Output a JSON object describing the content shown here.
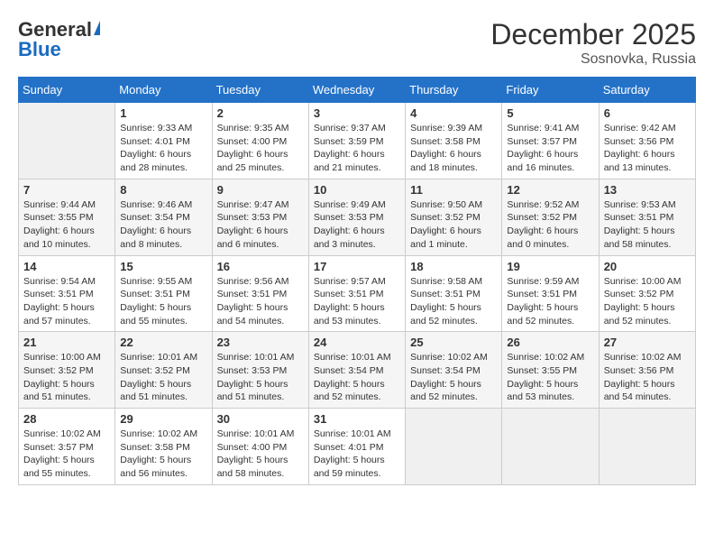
{
  "header": {
    "logo_general": "General",
    "logo_blue": "Blue",
    "month_title": "December 2025",
    "location": "Sosnovka, Russia"
  },
  "days_of_week": [
    "Sunday",
    "Monday",
    "Tuesday",
    "Wednesday",
    "Thursday",
    "Friday",
    "Saturday"
  ],
  "weeks": [
    [
      {
        "day": "",
        "sunrise": "",
        "sunset": "",
        "daylight": ""
      },
      {
        "day": "1",
        "sunrise": "9:33 AM",
        "sunset": "4:01 PM",
        "daylight": "6 hours and 28 minutes."
      },
      {
        "day": "2",
        "sunrise": "9:35 AM",
        "sunset": "4:00 PM",
        "daylight": "6 hours and 25 minutes."
      },
      {
        "day": "3",
        "sunrise": "9:37 AM",
        "sunset": "3:59 PM",
        "daylight": "6 hours and 21 minutes."
      },
      {
        "day": "4",
        "sunrise": "9:39 AM",
        "sunset": "3:58 PM",
        "daylight": "6 hours and 18 minutes."
      },
      {
        "day": "5",
        "sunrise": "9:41 AM",
        "sunset": "3:57 PM",
        "daylight": "6 hours and 16 minutes."
      },
      {
        "day": "6",
        "sunrise": "9:42 AM",
        "sunset": "3:56 PM",
        "daylight": "6 hours and 13 minutes."
      }
    ],
    [
      {
        "day": "7",
        "sunrise": "9:44 AM",
        "sunset": "3:55 PM",
        "daylight": "6 hours and 10 minutes."
      },
      {
        "day": "8",
        "sunrise": "9:46 AM",
        "sunset": "3:54 PM",
        "daylight": "6 hours and 8 minutes."
      },
      {
        "day": "9",
        "sunrise": "9:47 AM",
        "sunset": "3:53 PM",
        "daylight": "6 hours and 6 minutes."
      },
      {
        "day": "10",
        "sunrise": "9:49 AM",
        "sunset": "3:53 PM",
        "daylight": "6 hours and 3 minutes."
      },
      {
        "day": "11",
        "sunrise": "9:50 AM",
        "sunset": "3:52 PM",
        "daylight": "6 hours and 1 minute."
      },
      {
        "day": "12",
        "sunrise": "9:52 AM",
        "sunset": "3:52 PM",
        "daylight": "6 hours and 0 minutes."
      },
      {
        "day": "13",
        "sunrise": "9:53 AM",
        "sunset": "3:51 PM",
        "daylight": "5 hours and 58 minutes."
      }
    ],
    [
      {
        "day": "14",
        "sunrise": "9:54 AM",
        "sunset": "3:51 PM",
        "daylight": "5 hours and 57 minutes."
      },
      {
        "day": "15",
        "sunrise": "9:55 AM",
        "sunset": "3:51 PM",
        "daylight": "5 hours and 55 minutes."
      },
      {
        "day": "16",
        "sunrise": "9:56 AM",
        "sunset": "3:51 PM",
        "daylight": "5 hours and 54 minutes."
      },
      {
        "day": "17",
        "sunrise": "9:57 AM",
        "sunset": "3:51 PM",
        "daylight": "5 hours and 53 minutes."
      },
      {
        "day": "18",
        "sunrise": "9:58 AM",
        "sunset": "3:51 PM",
        "daylight": "5 hours and 52 minutes."
      },
      {
        "day": "19",
        "sunrise": "9:59 AM",
        "sunset": "3:51 PM",
        "daylight": "5 hours and 52 minutes."
      },
      {
        "day": "20",
        "sunrise": "10:00 AM",
        "sunset": "3:52 PM",
        "daylight": "5 hours and 52 minutes."
      }
    ],
    [
      {
        "day": "21",
        "sunrise": "10:00 AM",
        "sunset": "3:52 PM",
        "daylight": "5 hours and 51 minutes."
      },
      {
        "day": "22",
        "sunrise": "10:01 AM",
        "sunset": "3:52 PM",
        "daylight": "5 hours and 51 minutes."
      },
      {
        "day": "23",
        "sunrise": "10:01 AM",
        "sunset": "3:53 PM",
        "daylight": "5 hours and 51 minutes."
      },
      {
        "day": "24",
        "sunrise": "10:01 AM",
        "sunset": "3:54 PM",
        "daylight": "5 hours and 52 minutes."
      },
      {
        "day": "25",
        "sunrise": "10:02 AM",
        "sunset": "3:54 PM",
        "daylight": "5 hours and 52 minutes."
      },
      {
        "day": "26",
        "sunrise": "10:02 AM",
        "sunset": "3:55 PM",
        "daylight": "5 hours and 53 minutes."
      },
      {
        "day": "27",
        "sunrise": "10:02 AM",
        "sunset": "3:56 PM",
        "daylight": "5 hours and 54 minutes."
      }
    ],
    [
      {
        "day": "28",
        "sunrise": "10:02 AM",
        "sunset": "3:57 PM",
        "daylight": "5 hours and 55 minutes."
      },
      {
        "day": "29",
        "sunrise": "10:02 AM",
        "sunset": "3:58 PM",
        "daylight": "5 hours and 56 minutes."
      },
      {
        "day": "30",
        "sunrise": "10:01 AM",
        "sunset": "4:00 PM",
        "daylight": "5 hours and 58 minutes."
      },
      {
        "day": "31",
        "sunrise": "10:01 AM",
        "sunset": "4:01 PM",
        "daylight": "5 hours and 59 minutes."
      },
      {
        "day": "",
        "sunrise": "",
        "sunset": "",
        "daylight": ""
      },
      {
        "day": "",
        "sunrise": "",
        "sunset": "",
        "daylight": ""
      },
      {
        "day": "",
        "sunrise": "",
        "sunset": "",
        "daylight": ""
      }
    ]
  ],
  "labels": {
    "sunrise": "Sunrise:",
    "sunset": "Sunset:",
    "daylight": "Daylight:"
  }
}
